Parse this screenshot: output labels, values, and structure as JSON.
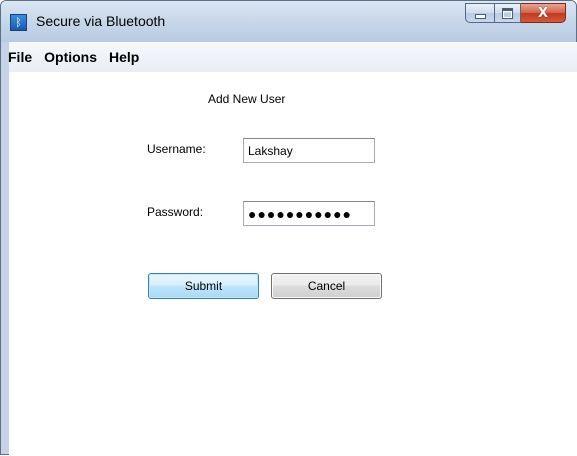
{
  "window": {
    "title": "Secure via Bluetooth",
    "close_glyph": "X"
  },
  "menu": {
    "items": [
      {
        "label": "File"
      },
      {
        "label": "Options"
      },
      {
        "label": "Help"
      }
    ]
  },
  "form": {
    "heading": "Add New User",
    "username_label": "Username:",
    "username_value": "Lakshay",
    "password_label": "Password:",
    "password_value": "●●●●●●●●●●●",
    "submit_label": "Submit",
    "cancel_label": "Cancel"
  },
  "icons": {
    "app": "bluetooth-app-icon",
    "minimize": "minimize-icon",
    "maximize": "maximize-icon",
    "close": "close-icon"
  },
  "colors": {
    "frame": "#c4d3e7",
    "close_button": "#c3391b",
    "submit_button": "#bee6fd"
  }
}
